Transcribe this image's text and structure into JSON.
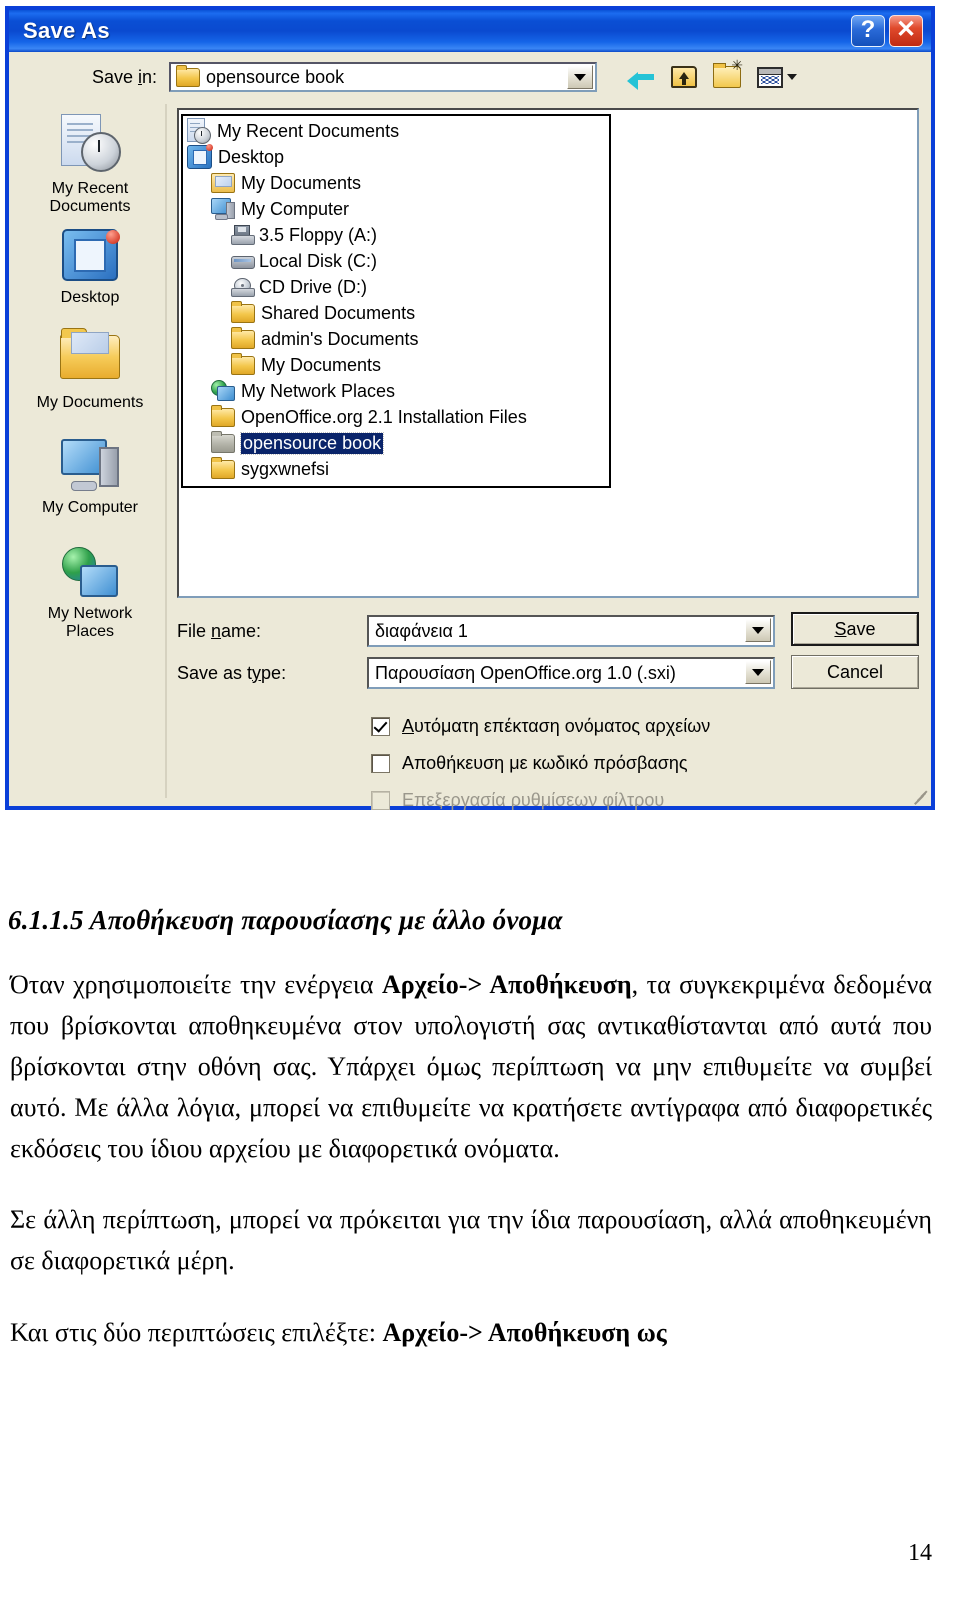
{
  "dialog": {
    "title": "Save As",
    "title_buttons": [
      {
        "name": "help-button",
        "glyph": "?"
      },
      {
        "name": "close-button",
        "glyph": "✕"
      }
    ],
    "save_in": {
      "label_pre": "Save ",
      "label_underline": "i",
      "label_post": "n:",
      "value": "opensource book"
    },
    "toolbar": [
      {
        "name": "back-icon",
        "title": "Back"
      },
      {
        "name": "up-one-level-icon",
        "title": "Up One Level"
      },
      {
        "name": "create-new-folder-icon",
        "title": "Create New Folder"
      },
      {
        "name": "views-icon",
        "title": "Views"
      }
    ],
    "places": [
      {
        "label_line1": "My Recent",
        "label_line2": "Documents",
        "icon": "recent-documents-icon"
      },
      {
        "label_line1": "Desktop",
        "label_line2": "",
        "icon": "desktop-icon"
      },
      {
        "label_line1": "My Documents",
        "label_line2": "",
        "icon": "my-documents-icon"
      },
      {
        "label_line1": "My Computer",
        "label_line2": "",
        "icon": "my-computer-icon"
      },
      {
        "label_line1": "My Network",
        "label_line2": "Places",
        "icon": "my-network-places-icon"
      }
    ],
    "dropdown_items": [
      {
        "label": "My Recent Documents",
        "icon": "recent-documents-icon",
        "indent": 0,
        "selected": false
      },
      {
        "label": "Desktop",
        "icon": "desktop-icon",
        "indent": 0,
        "selected": false
      },
      {
        "label": "My Documents",
        "icon": "my-documents-icon",
        "indent": 1,
        "selected": false
      },
      {
        "label": "My Computer",
        "icon": "my-computer-icon",
        "indent": 1,
        "selected": false
      },
      {
        "label": "3.5 Floppy (A:)",
        "icon": "floppy-drive-icon",
        "indent": 2,
        "selected": false
      },
      {
        "label": "Local Disk (C:)",
        "icon": "hard-disk-icon",
        "indent": 2,
        "selected": false
      },
      {
        "label": "CD Drive (D:)",
        "icon": "cd-drive-icon",
        "indent": 2,
        "selected": false
      },
      {
        "label": "Shared Documents",
        "icon": "folder-icon",
        "indent": 2,
        "selected": false
      },
      {
        "label": "admin's Documents",
        "icon": "folder-icon",
        "indent": 2,
        "selected": false
      },
      {
        "label": "My Documents",
        "icon": "folder-icon",
        "indent": 2,
        "selected": false
      },
      {
        "label": "My Network Places",
        "icon": "my-network-places-icon",
        "indent": 1,
        "selected": false
      },
      {
        "label": "OpenOffice.org 2.1 Installation Files",
        "icon": "folder-icon",
        "indent": 1,
        "selected": false
      },
      {
        "label": "opensource book",
        "icon": "folder-open-icon",
        "indent": 1,
        "selected": true
      },
      {
        "label": "sygxwnefsi",
        "icon": "folder-icon",
        "indent": 1,
        "selected": false
      }
    ],
    "fields": {
      "file_name": {
        "label_pre": "File ",
        "label_underline": "n",
        "label_post": "ame:",
        "value": "διαφάνεια 1"
      },
      "save_as_type": {
        "label_pre": "Save as t",
        "label_underline": "y",
        "label_post": "pe:",
        "value": "Παρουσίαση OpenOffice.org 1.0 (.sxi)"
      }
    },
    "buttons": {
      "save": {
        "pre": "",
        "underline": "S",
        "post": "ave"
      },
      "cancel": {
        "pre": "Cancel",
        "underline": "",
        "post": ""
      }
    },
    "checkboxes": [
      {
        "pre": "",
        "underline": "Α",
        "post": "υτόματη επέκταση ονόματος αρχείων",
        "checked": true,
        "disabled": false
      },
      {
        "pre": "Αποθήκευση με κωδικό πρόσβασης",
        "underline": "",
        "post": "",
        "checked": false,
        "disabled": false
      },
      {
        "pre": "Επεξεργασία ρυθμίσεων φίλτρου",
        "underline": "",
        "post": "",
        "checked": false,
        "disabled": true
      }
    ]
  },
  "document": {
    "heading": "6.1.1.5  Αποθήκευση παρουσίασης με άλλο όνομα",
    "paragraph1_a": "Όταν χρησιμοποιείτε την ενέργεια ",
    "paragraph1_bold": "Αρχείο-> Αποθήκευση",
    "paragraph1_b": ", τα συγκεκριμένα δεδομένα που βρίσκονται αποθηκευμένα στον υπολογιστή σας αντικαθίστανται από αυτά που βρίσκονται στην οθόνη σας.  Υπάρχει όμως περίπτωση να μην επιθυμείτε να συμβεί αυτό.  Με άλλα λόγια, μπορεί να επιθυμείτε να κρατήσετε αντίγραφα από διαφορετικές εκδόσεις του ίδιου αρχείου με διαφορετικά ονόματα.",
    "paragraph2": "Σε άλλη περίπτωση, μπορεί να πρόκειται για την ίδια παρουσίαση, αλλά αποθηκευμένη σε διαφορετικά μέρη.",
    "paragraph3_a": "Και στις δύο περιπτώσεις επιλέξτε:  ",
    "paragraph3_bold": "Αρχείο-> Αποθήκευση ως",
    "page_number": "14"
  },
  "colors": {
    "titlebar_blue": "#0a4fd4",
    "window_border": "#0a3fd8",
    "dialog_face": "#ece9d8",
    "selection_blue": "#0a246a",
    "close_red": "#c02a12"
  }
}
